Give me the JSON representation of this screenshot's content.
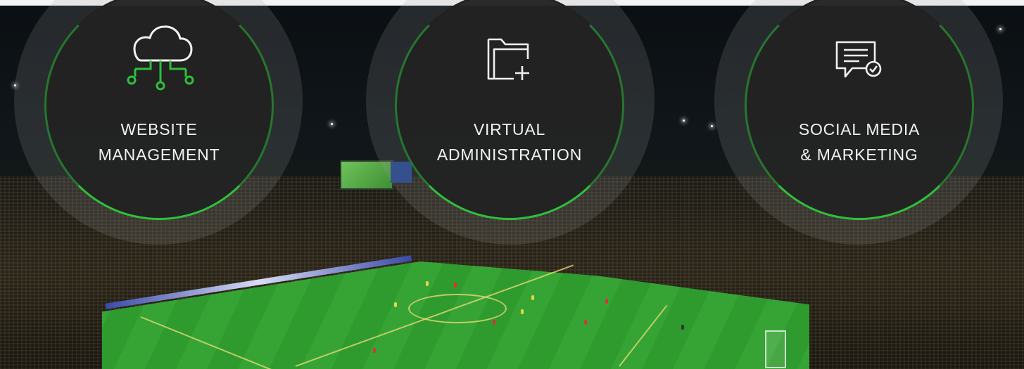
{
  "services": [
    {
      "line1": "WEBSITE",
      "line2": "MANAGEMENT",
      "icon": "cloud-network-icon"
    },
    {
      "line1": "VIRTUAL",
      "line2": "ADMINISTRATION",
      "icon": "folder-plus-icon"
    },
    {
      "line1": "SOCIAL MEDIA",
      "line2": "& MARKETING",
      "icon": "message-check-icon"
    }
  ],
  "colors": {
    "accent": "#2fbf3c",
    "disc": "#222222",
    "text": "#f2f2f2"
  }
}
